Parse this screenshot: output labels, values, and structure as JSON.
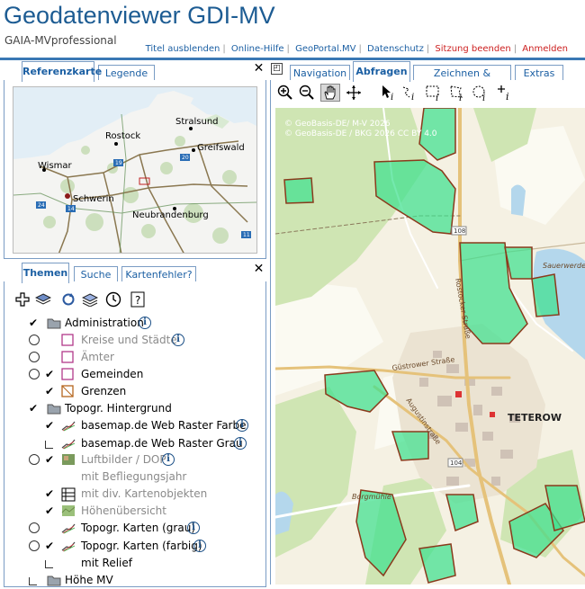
{
  "header": {
    "title": "Geodatenviewer GDI-MV",
    "subtitle": "GAIA-MVprofessional",
    "links": [
      "Titel ausblenden",
      "Online-Hilfe",
      "GeoPortal.MV",
      "Datenschutz"
    ],
    "red_links": [
      "Sitzung beenden",
      "Anmelden"
    ]
  },
  "top_left_tabs": {
    "active": "Referenzkarte",
    "other": "Legende"
  },
  "refmap_labels": {
    "stralsund": "Stralsund",
    "rostock": "Rostock",
    "greifswald": "Greifswald",
    "wismar": "Wismar",
    "schwerin": "Schwerin",
    "neubrandenburg": "Neubrandenburg",
    "r19": "19",
    "r20": "20",
    "r24": "24",
    "r14": "14",
    "r11": "11"
  },
  "bottom_left_tabs": {
    "active": "Themen",
    "search": "Suche",
    "errors": "Kartenfehler?"
  },
  "layers": [
    {
      "label": "Administration",
      "check": "✔",
      "type": "folder"
    },
    {
      "label": "Kreise und Städte",
      "check": "○",
      "type": "sq",
      "grey": true
    },
    {
      "label": "Ämter",
      "check": "○",
      "type": "sq",
      "grey": true
    },
    {
      "label": "Gemeinden",
      "check": "○✔",
      "type": "sq"
    },
    {
      "label": "Grenzen",
      "check": "✔",
      "type": "grenzen"
    },
    {
      "label": "Topogr. Hintergrund",
      "check": "✔",
      "type": "folder"
    },
    {
      "label": "basemap.de Web Raster Farbe",
      "check": "✔",
      "type": "line"
    },
    {
      "label": "basemap.de Web Raster Grau",
      "check": "",
      "type": "line"
    },
    {
      "label": "Luftbilder / DOP",
      "check": "○✔",
      "type": "photo",
      "grey": true
    },
    {
      "label": "mit Befliegungsjahr",
      "check": "",
      "grey": true
    },
    {
      "label": "mit div. Kartenobjekten",
      "check": "✔",
      "type": "grid",
      "grey": true
    },
    {
      "label": "Höhenübersicht",
      "check": "✔",
      "type": "relief",
      "grey": true
    },
    {
      "label": "Topogr. Karten (grau)",
      "check": "○",
      "type": "line"
    },
    {
      "label": "Topogr. Karten (farbig)",
      "check": "○✔",
      "type": "line"
    },
    {
      "label": "mit Relief",
      "check": ""
    },
    {
      "label": "Höhe MV",
      "check": "",
      "type": "folder"
    }
  ],
  "info_glyph": "i",
  "main_tabs": [
    "Navigation",
    "Abfragen",
    "Zeichnen & Messen",
    "Extras"
  ],
  "map": {
    "copyright1": "© GeoBasis-DE/ M-V 2026",
    "copyright2": "© GeoBasis-DE / BKG 2026 CC BY 4.0",
    "teterow": "TETEROW",
    "rostocker": "Rostocker Straße",
    "guestrower": "Güstrower Straße",
    "augustin": "Augustinstraße",
    "borgmuehle": "Borgmühle",
    "sauerwerder": "Sauerwerder",
    "r108": "108",
    "r104": "104"
  },
  "colors": {
    "accent": "#1d5c93",
    "link": "#1b5fa3",
    "red": "#cc1f1f",
    "highlight": "#3ee08f"
  }
}
